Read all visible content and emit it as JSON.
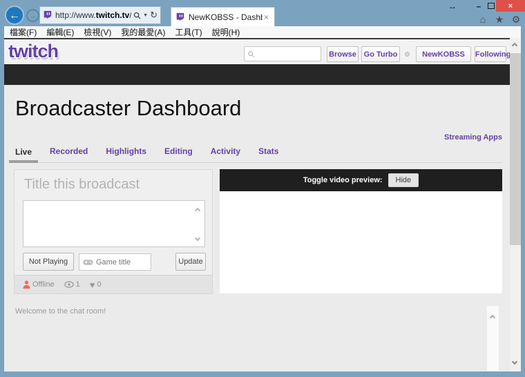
{
  "window": {
    "controls": {
      "resize": "↔",
      "minimize": "–",
      "close": "×"
    },
    "toolbar_icons": {
      "home": "⌂",
      "favorites": "★",
      "tools": "⚙"
    }
  },
  "browser": {
    "back": "←",
    "forward": "→",
    "address": {
      "url_prefix": "http://www.",
      "url_domain": "twitch.tv",
      "url_path": "/broadca",
      "dropdown": "▼",
      "refresh": "↻"
    },
    "tab": {
      "title": "NewKOBSS - Dashboard",
      "close": "×"
    },
    "menu": [
      "檔案(F)",
      "編輯(E)",
      "檢視(V)",
      "我的最愛(A)",
      "工具(T)",
      "說明(H)"
    ]
  },
  "site_nav": {
    "logo": "twitch",
    "search_placeholder": "",
    "browse": "Browse",
    "go_turbo": "Go Turbo",
    "username": "NewKOBSS",
    "following": "Following"
  },
  "dashboard": {
    "title": "Broadcaster Dashboard",
    "streaming_apps": "Streaming Apps",
    "tabs": [
      "Live",
      "Recorded",
      "Highlights",
      "Editing",
      "Activity",
      "Stats"
    ]
  },
  "broadcast_panel": {
    "heading": "Title this broadcast",
    "not_playing": "Not Playing",
    "game_placeholder": "Game title",
    "update": "Update",
    "status": {
      "offline": "Offline",
      "viewer_count": "1",
      "heart_icon": "♥",
      "heart_count": "0"
    }
  },
  "preview": {
    "toggle_label": "Toggle video preview:",
    "hide": "Hide"
  },
  "chat": {
    "welcome": "Welcome to the chat room!"
  },
  "colors": {
    "brand_purple": "#6441a5",
    "titlebar_blue": "#7ba2bf",
    "close_red": "#e0504a",
    "dark_band": "#272727"
  }
}
